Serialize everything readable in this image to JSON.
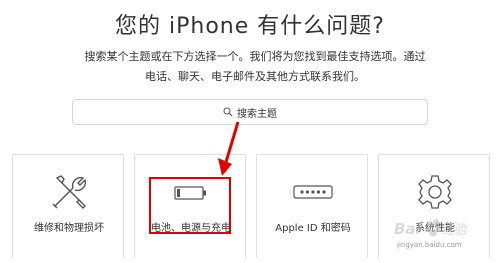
{
  "header": {
    "title": "您的 iPhone 有什么问题?",
    "subtitle_line1": "搜索某个主题或在下方选择一个。我们将为您找到最佳支持选项。通过",
    "subtitle_line2": "电话、聊天、电子邮件及其他方式联系我们。"
  },
  "search": {
    "placeholder": "搜索主题"
  },
  "topics": [
    {
      "label": "维修和物理损坏",
      "icon": "wrench-screwdriver-icon"
    },
    {
      "label": "电池、电源与充电",
      "icon": "battery-icon"
    },
    {
      "label": "Apple ID 和密码",
      "icon": "password-dots-icon"
    },
    {
      "label": "系统性能",
      "icon": "gear-icon"
    }
  ],
  "annotation": {
    "highlight_color": "#e00000"
  },
  "watermark": {
    "brand": "Baidu 经验",
    "url": "jingyan.baidu.com"
  }
}
